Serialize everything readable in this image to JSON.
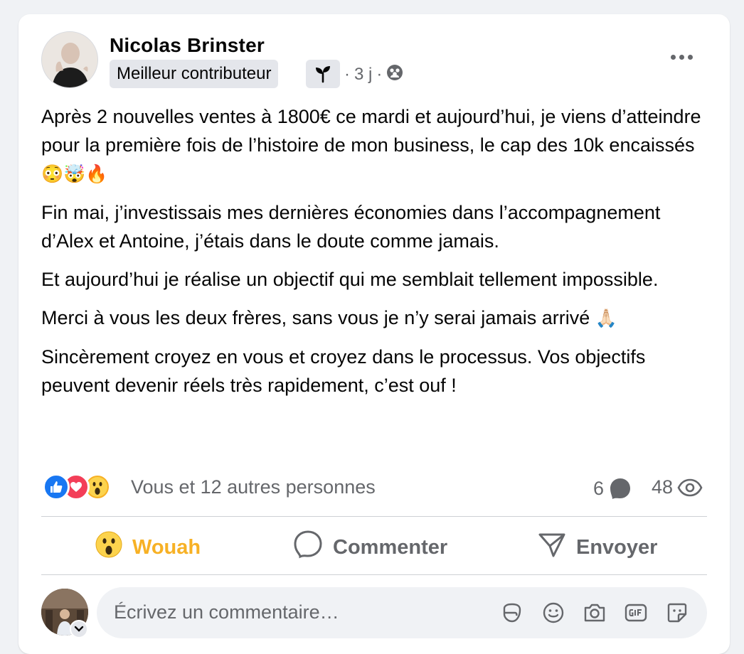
{
  "post": {
    "author": "Nicolas Brinster",
    "badge": "Meilleur contributeur",
    "time": "3 j",
    "separator": "·",
    "paragraphs": [
      {
        "text": "Après 2 nouvelles ventes à 1800€ ce mardi et aujourd’hui, je viens d’atteindre pour la première fois de l’histoire de mon business, le cap des 10k encaissés ",
        "emoji": "😳🤯🔥"
      },
      {
        "text": "Fin mai, j’investissais mes dernières économies dans l’accompagnement d’Alex et Antoine, j’étais dans le doute comme jamais.",
        "emoji": ""
      },
      {
        "text": "Et aujourd’hui je réalise un objectif qui me semblait tellement impossible.",
        "emoji": ""
      },
      {
        "text": "Merci à vous les deux frères, sans vous je n’y serai jamais arrivé ",
        "emoji": "🙏🏻"
      },
      {
        "text": "Sincèrement croyez en vous et croyez dans le processus. Vos objectifs peuvent devenir réels très rapidement, c’est ouf !",
        "emoji": ""
      }
    ]
  },
  "reactions": {
    "summary": "Vous et 12 autres personnes",
    "comments_count": "6",
    "views_count": "48",
    "icons": [
      "like-icon",
      "love-icon",
      "wow-icon"
    ]
  },
  "actions": {
    "react_label": "Wouah",
    "react_emoji": "😮",
    "comment_label": "Commenter",
    "send_label": "Envoyer"
  },
  "comment_input": {
    "placeholder": "Écrivez un commentaire…"
  },
  "colors": {
    "wouah": "#f7b125",
    "like": "#1877f2",
    "love": "#f33e58",
    "secondary_text": "#65676b"
  }
}
